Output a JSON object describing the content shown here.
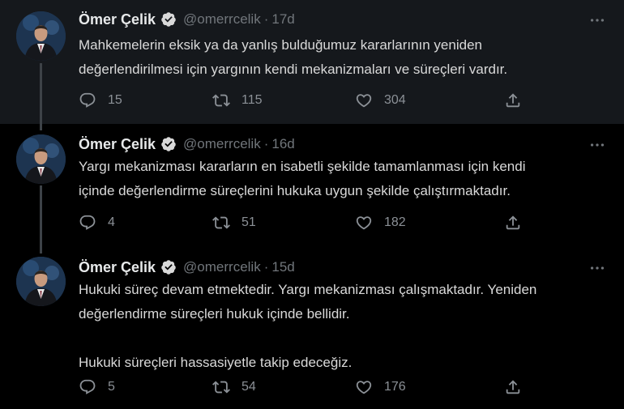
{
  "colors": {
    "background": "#000000",
    "highlight_background": "#15181c",
    "text": "#d9d9d9",
    "muted": "#71767b",
    "verified": "#d9d9d9",
    "thread_line": "#3d4247"
  },
  "tweets": [
    {
      "author": {
        "name": "Ömer Çelik",
        "handle": "@omerrcelik",
        "verified": true
      },
      "separator": "·",
      "time": "17d",
      "text_lines": [
        "Mahkemelerin eksik ya da yanlış bulduğumuz kararlarının yeniden",
        "değerlendirilmesi için yargının kendi mekanizmaları ve süreçleri vardır."
      ],
      "replies": "15",
      "retweets": "115",
      "likes": "304"
    },
    {
      "author": {
        "name": "Ömer Çelik",
        "handle": "@omerrcelik",
        "verified": true
      },
      "separator": "·",
      "time": "16d",
      "text_lines": [
        "Yargı mekanizması kararların en isabetli şekilde tamamlanması için kendi",
        "içinde değerlendirme süreçlerini hukuka uygun şekilde çalıştırmaktadır."
      ],
      "replies": "4",
      "retweets": "51",
      "likes": "182"
    },
    {
      "author": {
        "name": "Ömer Çelik",
        "handle": "@omerrcelik",
        "verified": true
      },
      "separator": "·",
      "time": "15d",
      "text_lines": [
        "Hukuki süreç devam etmektedir. Yargı mekanizması çalışmaktadır. Yeniden",
        "değerlendirme süreçleri hukuk içinde bellidir.",
        "",
        "Hukuki süreçleri hassasiyetle takip edeceğiz."
      ],
      "replies": "5",
      "retweets": "54",
      "likes": "176"
    }
  ],
  "icons": {
    "verified": "verified-badge-icon",
    "more": "more-options-icon",
    "reply": "reply-icon",
    "retweet": "retweet-icon",
    "like": "like-icon",
    "share": "share-icon"
  }
}
